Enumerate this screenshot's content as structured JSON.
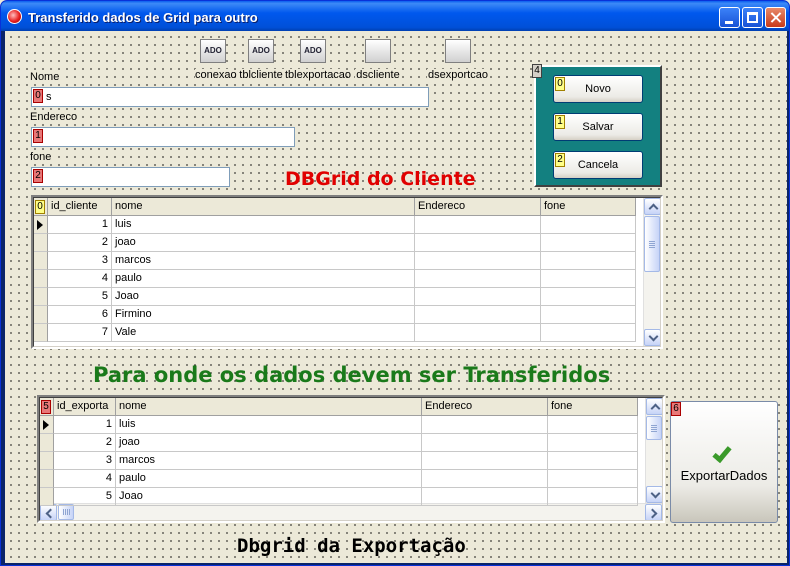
{
  "window": {
    "title": "Transferido dados de Grid para outro"
  },
  "components": [
    {
      "icon": "ado-connection-icon",
      "glyph": "ADO",
      "label": "conexao"
    },
    {
      "icon": "ado-table-icon",
      "glyph": "ADO",
      "label": "tblcliente"
    },
    {
      "icon": "ado-table-icon",
      "glyph": "ADO",
      "label": "tblexportacao"
    },
    {
      "icon": "datasource-icon",
      "glyph": "",
      "label": "dscliente"
    },
    {
      "icon": "datasource-icon",
      "glyph": "",
      "label": "dsexportcao"
    }
  ],
  "form": {
    "nome_label": "Nome",
    "nome_value": "s",
    "nome_tab": "0",
    "endereco_label": "Endereco",
    "endereco_value": "",
    "endereco_tab": "1",
    "fone_label": "fone",
    "fone_value": "",
    "fone_tab": "2"
  },
  "panel": {
    "tab": "4",
    "buttons": [
      {
        "tab": "0",
        "label": "Novo"
      },
      {
        "tab": "1",
        "label": "Salvar"
      },
      {
        "tab": "2",
        "label": "Cancela"
      }
    ]
  },
  "captions": {
    "cliente_grid_title": "DBGrid do Cliente",
    "transfer_title": "Para onde os dados devem ser Transferidos",
    "export_grid_title": "Dbgrid da Exportação"
  },
  "grid_cliente": {
    "tab": "0",
    "columns": [
      "id_cliente",
      "nome",
      "Endereco",
      "fone"
    ],
    "rows": [
      [
        "1",
        "luis",
        "",
        ""
      ],
      [
        "2",
        "joao",
        "",
        ""
      ],
      [
        "3",
        "marcos",
        "",
        ""
      ],
      [
        "4",
        "paulo",
        "",
        ""
      ],
      [
        "5",
        "Joao",
        "",
        ""
      ],
      [
        "6",
        "Firmino",
        "",
        ""
      ],
      [
        "7",
        "Vale",
        "",
        ""
      ]
    ],
    "current_row": 0
  },
  "grid_exportacao": {
    "tab": "5",
    "columns": [
      "id_exporta",
      "nome",
      "Endereco",
      "fone"
    ],
    "rows": [
      [
        "1",
        "luis",
        "",
        ""
      ],
      [
        "2",
        "joao",
        "",
        ""
      ],
      [
        "3",
        "marcos",
        "",
        ""
      ],
      [
        "4",
        "paulo",
        "",
        ""
      ],
      [
        "5",
        "Joao",
        "",
        ""
      ]
    ],
    "current_row": 0
  },
  "export_button": {
    "tab": "6",
    "label": "ExportarDados"
  },
  "colors": {
    "panel": "#138080",
    "cliente_caption": "#e00000",
    "transfer_caption": "#1a7a1a"
  }
}
